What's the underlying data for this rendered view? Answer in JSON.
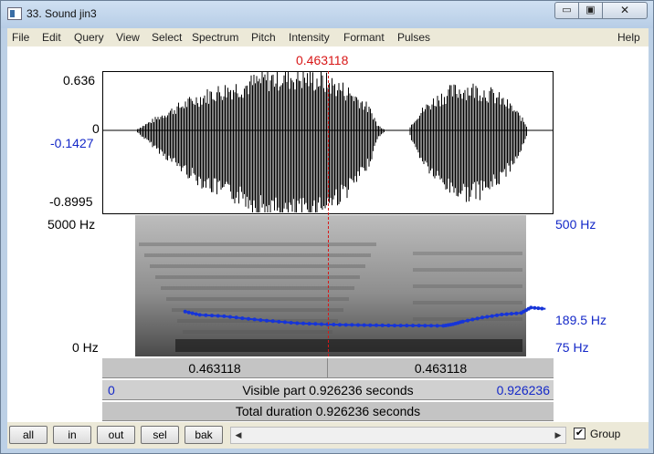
{
  "window": {
    "title": "33. Sound jin3",
    "minimize_glyph": "▭",
    "maximize_glyph": "▣",
    "close_glyph": "✕"
  },
  "menu": {
    "items": [
      "File",
      "Edit",
      "Query",
      "View",
      "Select",
      "Spectrum",
      "Pitch",
      "Intensity",
      "Formant",
      "Pulses"
    ],
    "help": "Help"
  },
  "cursor": {
    "time": "0.463118"
  },
  "waveform": {
    "max_label": "0.636",
    "zero_label": "0",
    "cursor_value": "-0.1427",
    "min_label": "-0.8995"
  },
  "spectrogram": {
    "freq_top": "5000 Hz",
    "freq_bottom": "0 Hz",
    "pitch_top": "500 Hz",
    "pitch_cursor": "189.5 Hz",
    "pitch_bottom": "75 Hz"
  },
  "time_bars": {
    "left_segment": "0.463118",
    "right_segment": "0.463118",
    "visible_start": "0",
    "visible_part": "Visible part 0.926236 seconds",
    "visible_end": "0.926236",
    "total_duration": "Total duration 0.926236 seconds"
  },
  "buttons": {
    "all": "all",
    "in": "in",
    "out": "out",
    "sel": "sel",
    "bak": "bak"
  },
  "scroll": {
    "left_arrow": "◀",
    "right_arrow": "▶"
  },
  "group": {
    "label": "Group",
    "checked": true,
    "check_glyph": "✔"
  },
  "pitch_track": {
    "times": [
      0.17,
      0.2,
      0.25,
      0.3,
      0.35,
      0.4,
      0.45,
      0.5,
      0.55,
      0.6,
      0.65,
      0.7,
      0.72,
      0.74,
      0.78,
      0.82,
      0.86,
      0.88,
      0.91
    ],
    "pitch_hz": [
      210,
      200,
      196,
      188,
      181,
      175,
      172,
      170,
      169,
      168,
      168,
      167,
      172,
      180,
      192,
      201,
      206,
      222,
      218
    ]
  }
}
